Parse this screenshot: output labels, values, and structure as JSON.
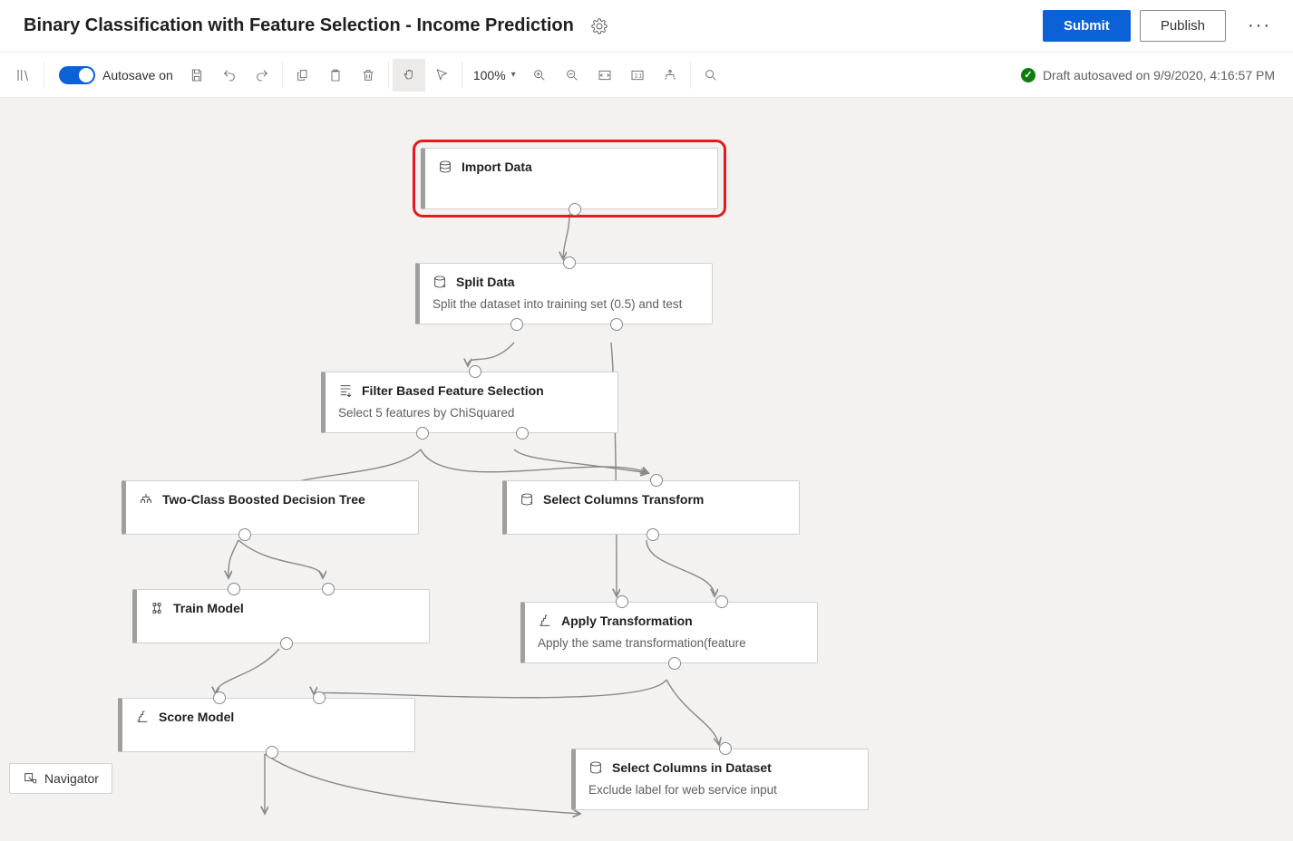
{
  "header": {
    "title": "Binary Classification with Feature Selection - Income Prediction",
    "submit": "Submit",
    "publish": "Publish"
  },
  "toolbar": {
    "autosave_label": "Autosave on",
    "zoom": "100%"
  },
  "status": {
    "text": "Draft autosaved on 9/9/2020, 4:16:57 PM"
  },
  "navigator": {
    "label": "Navigator"
  },
  "nodes": {
    "import_data": {
      "title": "Import Data"
    },
    "split_data": {
      "title": "Split Data",
      "desc": "Split the dataset into training set (0.5) and test"
    },
    "fbfs": {
      "title": "Filter Based Feature Selection",
      "desc": "Select 5 features by ChiSquared"
    },
    "two_class": {
      "title": "Two-Class Boosted Decision Tree"
    },
    "select_cols_transform": {
      "title": "Select Columns Transform"
    },
    "train_model": {
      "title": "Train Model"
    },
    "apply_transform": {
      "title": "Apply Transformation",
      "desc": "Apply the same transformation(feature"
    },
    "score_model": {
      "title": "Score Model"
    },
    "select_cols_dataset": {
      "title": "Select Columns in Dataset",
      "desc": "Exclude label for web service input"
    }
  }
}
